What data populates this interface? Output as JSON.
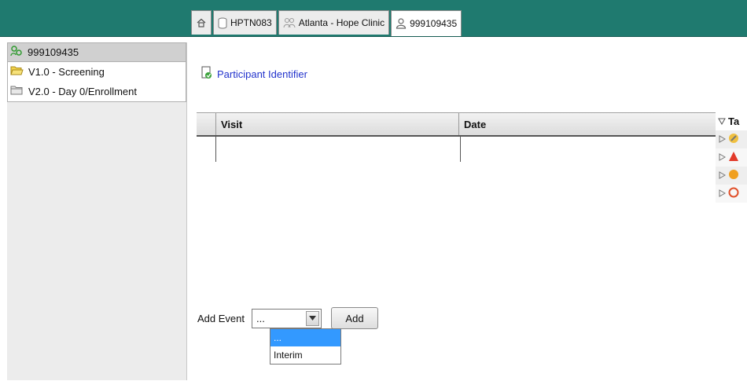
{
  "tabs": [
    {
      "label": "",
      "icon": "home-icon"
    },
    {
      "label": "HPTN083",
      "icon": "database-icon"
    },
    {
      "label": "Atlanta - Hope Clinic",
      "icon": "group-icon"
    },
    {
      "label": "999109435",
      "icon": "person-icon"
    }
  ],
  "sidebar": {
    "items": [
      {
        "label": "999109435",
        "icon": "participant-icon"
      },
      {
        "label": "V1.0 - Screening",
        "icon": "folder-open-icon"
      },
      {
        "label": "V2.0 - Day 0/Enrollment",
        "icon": "folder-icon"
      }
    ]
  },
  "main": {
    "participant_link": "Participant Identifier",
    "table": {
      "columns": [
        "Visit",
        "Date"
      ]
    },
    "right_panel": {
      "header": "Ta"
    }
  },
  "add_event": {
    "label": "Add Event",
    "selected": "...",
    "button": "Add",
    "options": [
      "...",
      "Interim"
    ]
  },
  "colors": {
    "topbar": "#1f7a6f",
    "link": "#2233cc",
    "highlight": "#3399ff"
  }
}
